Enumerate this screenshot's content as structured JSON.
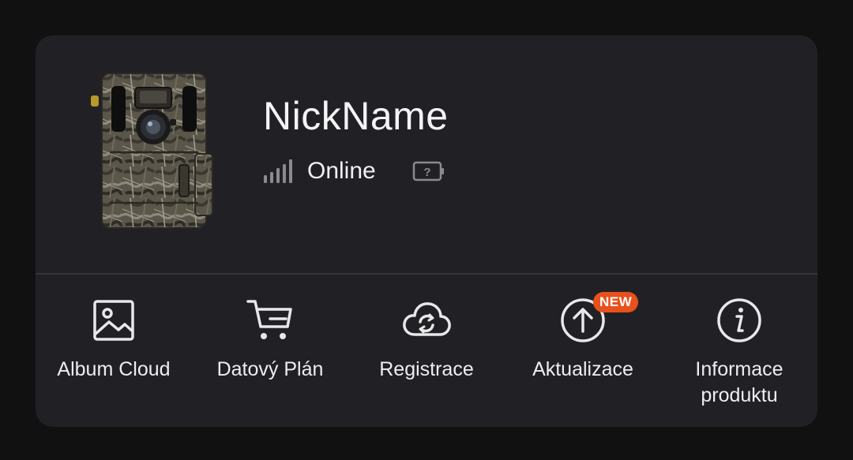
{
  "device": {
    "name": "NickName",
    "status": "Online",
    "image_icon": "trail-camera-image",
    "signal_icon": "signal-bars-icon",
    "battery_icon": "battery-unknown-icon",
    "battery_symbol": "?"
  },
  "actions": [
    {
      "label": "Album Cloud",
      "icon": "image-icon"
    },
    {
      "label": "Datový Plán",
      "icon": "cart-icon"
    },
    {
      "label": "Registrace",
      "icon": "cloud-sync-icon"
    },
    {
      "label": "Aktualizace",
      "icon": "upload-arrow-icon",
      "badge": "NEW"
    },
    {
      "label": "Informace\nproduktu",
      "icon": "info-icon"
    }
  ],
  "colors": {
    "background": "#111112",
    "card": "#212125",
    "text": "#f2f2f4",
    "badge": "#e8501c",
    "icon_muted": "#8a8a90"
  }
}
